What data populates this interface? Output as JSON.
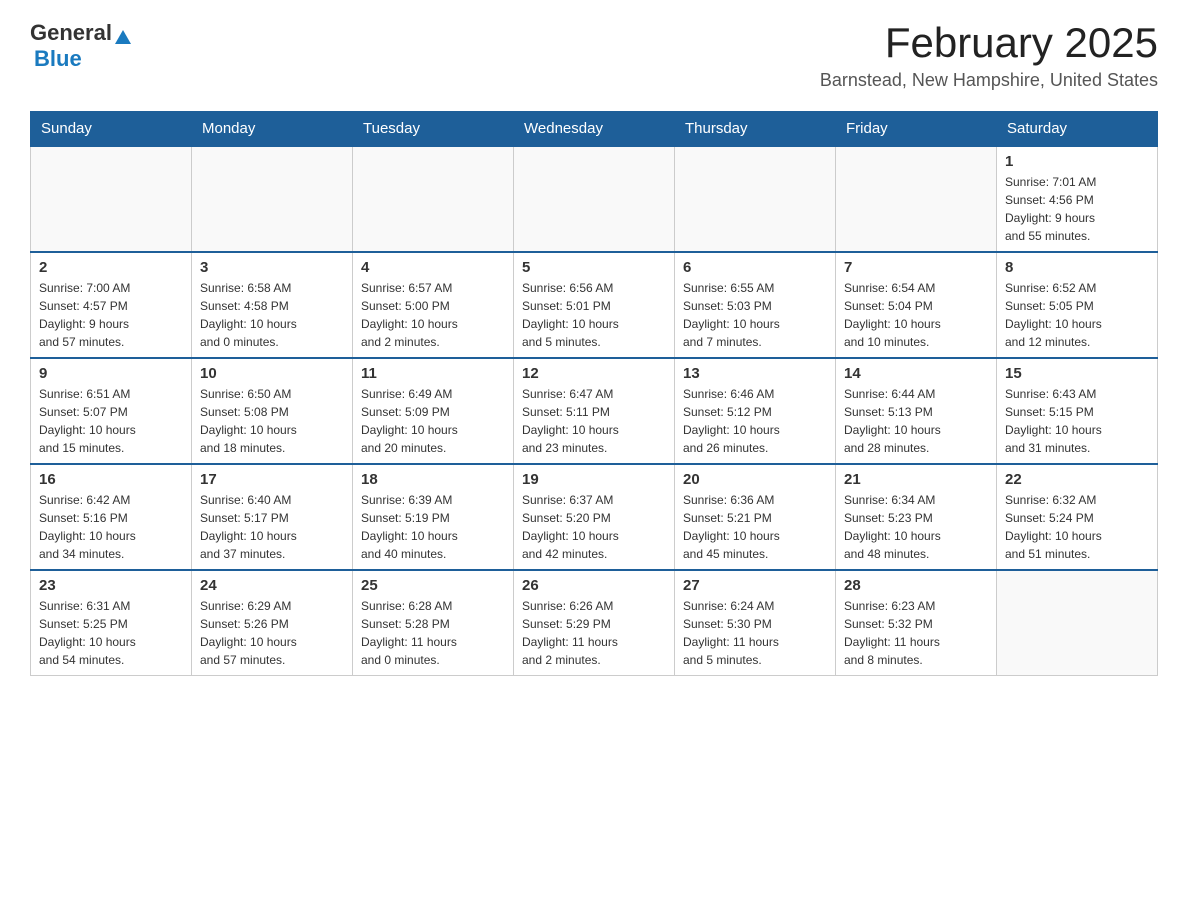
{
  "header": {
    "logo_general": "General",
    "logo_blue": "Blue",
    "month_title": "February 2025",
    "location": "Barnstead, New Hampshire, United States"
  },
  "days_of_week": [
    "Sunday",
    "Monday",
    "Tuesday",
    "Wednesday",
    "Thursday",
    "Friday",
    "Saturday"
  ],
  "weeks": [
    [
      {
        "day": "",
        "info": ""
      },
      {
        "day": "",
        "info": ""
      },
      {
        "day": "",
        "info": ""
      },
      {
        "day": "",
        "info": ""
      },
      {
        "day": "",
        "info": ""
      },
      {
        "day": "",
        "info": ""
      },
      {
        "day": "1",
        "info": "Sunrise: 7:01 AM\nSunset: 4:56 PM\nDaylight: 9 hours\nand 55 minutes."
      }
    ],
    [
      {
        "day": "2",
        "info": "Sunrise: 7:00 AM\nSunset: 4:57 PM\nDaylight: 9 hours\nand 57 minutes."
      },
      {
        "day": "3",
        "info": "Sunrise: 6:58 AM\nSunset: 4:58 PM\nDaylight: 10 hours\nand 0 minutes."
      },
      {
        "day": "4",
        "info": "Sunrise: 6:57 AM\nSunset: 5:00 PM\nDaylight: 10 hours\nand 2 minutes."
      },
      {
        "day": "5",
        "info": "Sunrise: 6:56 AM\nSunset: 5:01 PM\nDaylight: 10 hours\nand 5 minutes."
      },
      {
        "day": "6",
        "info": "Sunrise: 6:55 AM\nSunset: 5:03 PM\nDaylight: 10 hours\nand 7 minutes."
      },
      {
        "day": "7",
        "info": "Sunrise: 6:54 AM\nSunset: 5:04 PM\nDaylight: 10 hours\nand 10 minutes."
      },
      {
        "day": "8",
        "info": "Sunrise: 6:52 AM\nSunset: 5:05 PM\nDaylight: 10 hours\nand 12 minutes."
      }
    ],
    [
      {
        "day": "9",
        "info": "Sunrise: 6:51 AM\nSunset: 5:07 PM\nDaylight: 10 hours\nand 15 minutes."
      },
      {
        "day": "10",
        "info": "Sunrise: 6:50 AM\nSunset: 5:08 PM\nDaylight: 10 hours\nand 18 minutes."
      },
      {
        "day": "11",
        "info": "Sunrise: 6:49 AM\nSunset: 5:09 PM\nDaylight: 10 hours\nand 20 minutes."
      },
      {
        "day": "12",
        "info": "Sunrise: 6:47 AM\nSunset: 5:11 PM\nDaylight: 10 hours\nand 23 minutes."
      },
      {
        "day": "13",
        "info": "Sunrise: 6:46 AM\nSunset: 5:12 PM\nDaylight: 10 hours\nand 26 minutes."
      },
      {
        "day": "14",
        "info": "Sunrise: 6:44 AM\nSunset: 5:13 PM\nDaylight: 10 hours\nand 28 minutes."
      },
      {
        "day": "15",
        "info": "Sunrise: 6:43 AM\nSunset: 5:15 PM\nDaylight: 10 hours\nand 31 minutes."
      }
    ],
    [
      {
        "day": "16",
        "info": "Sunrise: 6:42 AM\nSunset: 5:16 PM\nDaylight: 10 hours\nand 34 minutes."
      },
      {
        "day": "17",
        "info": "Sunrise: 6:40 AM\nSunset: 5:17 PM\nDaylight: 10 hours\nand 37 minutes."
      },
      {
        "day": "18",
        "info": "Sunrise: 6:39 AM\nSunset: 5:19 PM\nDaylight: 10 hours\nand 40 minutes."
      },
      {
        "day": "19",
        "info": "Sunrise: 6:37 AM\nSunset: 5:20 PM\nDaylight: 10 hours\nand 42 minutes."
      },
      {
        "day": "20",
        "info": "Sunrise: 6:36 AM\nSunset: 5:21 PM\nDaylight: 10 hours\nand 45 minutes."
      },
      {
        "day": "21",
        "info": "Sunrise: 6:34 AM\nSunset: 5:23 PM\nDaylight: 10 hours\nand 48 minutes."
      },
      {
        "day": "22",
        "info": "Sunrise: 6:32 AM\nSunset: 5:24 PM\nDaylight: 10 hours\nand 51 minutes."
      }
    ],
    [
      {
        "day": "23",
        "info": "Sunrise: 6:31 AM\nSunset: 5:25 PM\nDaylight: 10 hours\nand 54 minutes."
      },
      {
        "day": "24",
        "info": "Sunrise: 6:29 AM\nSunset: 5:26 PM\nDaylight: 10 hours\nand 57 minutes."
      },
      {
        "day": "25",
        "info": "Sunrise: 6:28 AM\nSunset: 5:28 PM\nDaylight: 11 hours\nand 0 minutes."
      },
      {
        "day": "26",
        "info": "Sunrise: 6:26 AM\nSunset: 5:29 PM\nDaylight: 11 hours\nand 2 minutes."
      },
      {
        "day": "27",
        "info": "Sunrise: 6:24 AM\nSunset: 5:30 PM\nDaylight: 11 hours\nand 5 minutes."
      },
      {
        "day": "28",
        "info": "Sunrise: 6:23 AM\nSunset: 5:32 PM\nDaylight: 11 hours\nand 8 minutes."
      },
      {
        "day": "",
        "info": ""
      }
    ]
  ]
}
